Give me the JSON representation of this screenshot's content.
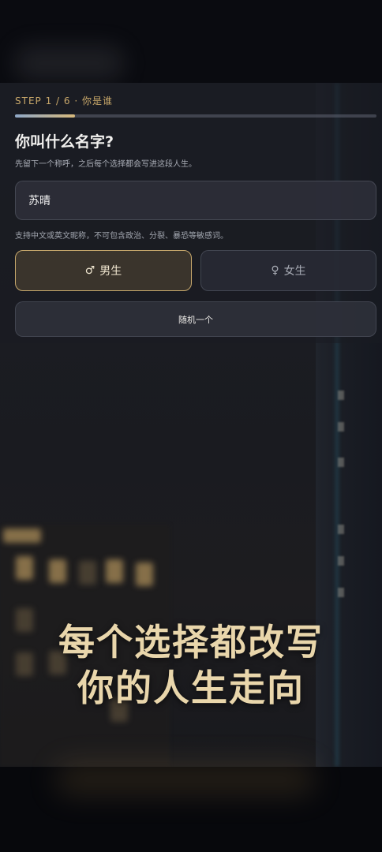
{
  "step": {
    "label": "STEP 1 / 6 · 你是谁",
    "current": 1,
    "total": 6,
    "progress_fraction": 0.167
  },
  "form": {
    "title": "你叫什么名字?",
    "subtitle": "先留下一个称呼，之后每个选择都会写进这段人生。",
    "name_value": "苏晴",
    "hint": "支持中文或英文昵称，不可包含政治、分裂、暴恐等敏感词。"
  },
  "gender": {
    "male_symbol": "♂",
    "male_label": "男生",
    "female_symbol": "♀",
    "female_label": "女生",
    "selected": "male"
  },
  "random_label": "随机一个",
  "tagline": {
    "line1": "每个选择都改写",
    "line2": "你的人生走向"
  },
  "colors": {
    "accent_gold": "#c9a86a",
    "tagline_gold": "#e9d6ab",
    "background": "#1b1c22"
  }
}
